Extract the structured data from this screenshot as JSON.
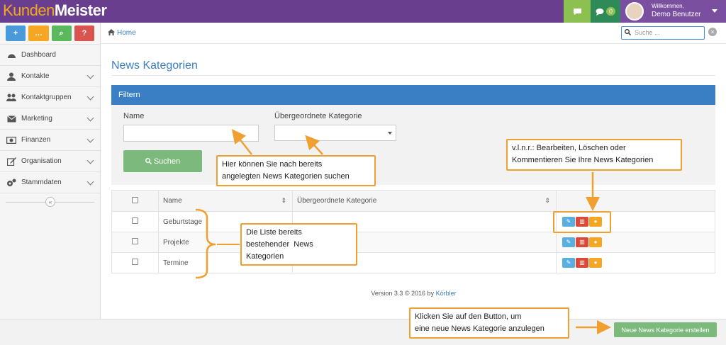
{
  "brand": {
    "part1": "Kunden",
    "part2": "Meister"
  },
  "header": {
    "message_badge": "0",
    "welcome": "Willkommen,",
    "user_name": "Demo Benutzer"
  },
  "sidebar": {
    "quick_buttons": [
      {
        "glyph": "+",
        "color": "#4a9ad9",
        "icon": "plus-icon"
      },
      {
        "glyph": "…",
        "color": "#f5a623",
        "icon": "chat-icon"
      },
      {
        "glyph": "⌕",
        "color": "#5cb85c",
        "icon": "search-icon"
      },
      {
        "glyph": "?",
        "color": "#d9534f",
        "icon": "help-icon"
      }
    ],
    "items": [
      {
        "label": "Dashboard"
      },
      {
        "label": "Kontakte"
      },
      {
        "label": "Kontaktgruppen"
      },
      {
        "label": "Marketing"
      },
      {
        "label": "Finanzen"
      },
      {
        "label": "Organisation"
      },
      {
        "label": "Stammdaten"
      }
    ]
  },
  "breadcrumb": {
    "home": "Home"
  },
  "search": {
    "placeholder": "Suche ..."
  },
  "page": {
    "title": "News Kategorien"
  },
  "filter": {
    "title": "Filtern",
    "name_label": "Name",
    "parent_label": "Übergeordnete Kategorie",
    "search_button": "Suchen"
  },
  "table": {
    "headers": [
      "Name",
      "Übergeordnete Kategorie"
    ],
    "rows": [
      {
        "name": "Geburtstage",
        "parent": ""
      },
      {
        "name": "Projekte",
        "parent": ""
      },
      {
        "name": "Termine",
        "parent": ""
      }
    ]
  },
  "footer": {
    "text": "Version 3.3 © 2016 by",
    "link": "Körbler"
  },
  "actions": {
    "new_category": "Neue News Kategorie erstellen"
  },
  "annotations": {
    "search_hint_1": "Hier können Sie nach bereits",
    "search_hint_2": "angelegten News Kategorien suchen",
    "actions_hint_1": "v.l.n.r.: Bearbeiten, Löschen oder",
    "actions_hint_2": "Kommentieren Sie Ihre News Kategorien",
    "list_hint_1": "Die Liste bereits",
    "list_hint_2": "bestehender  News",
    "list_hint_3": "Kategorien",
    "new_hint_1": "Klicken Sie auf den Button, um",
    "new_hint_2": "eine neue News Kategorie anzulegen"
  }
}
